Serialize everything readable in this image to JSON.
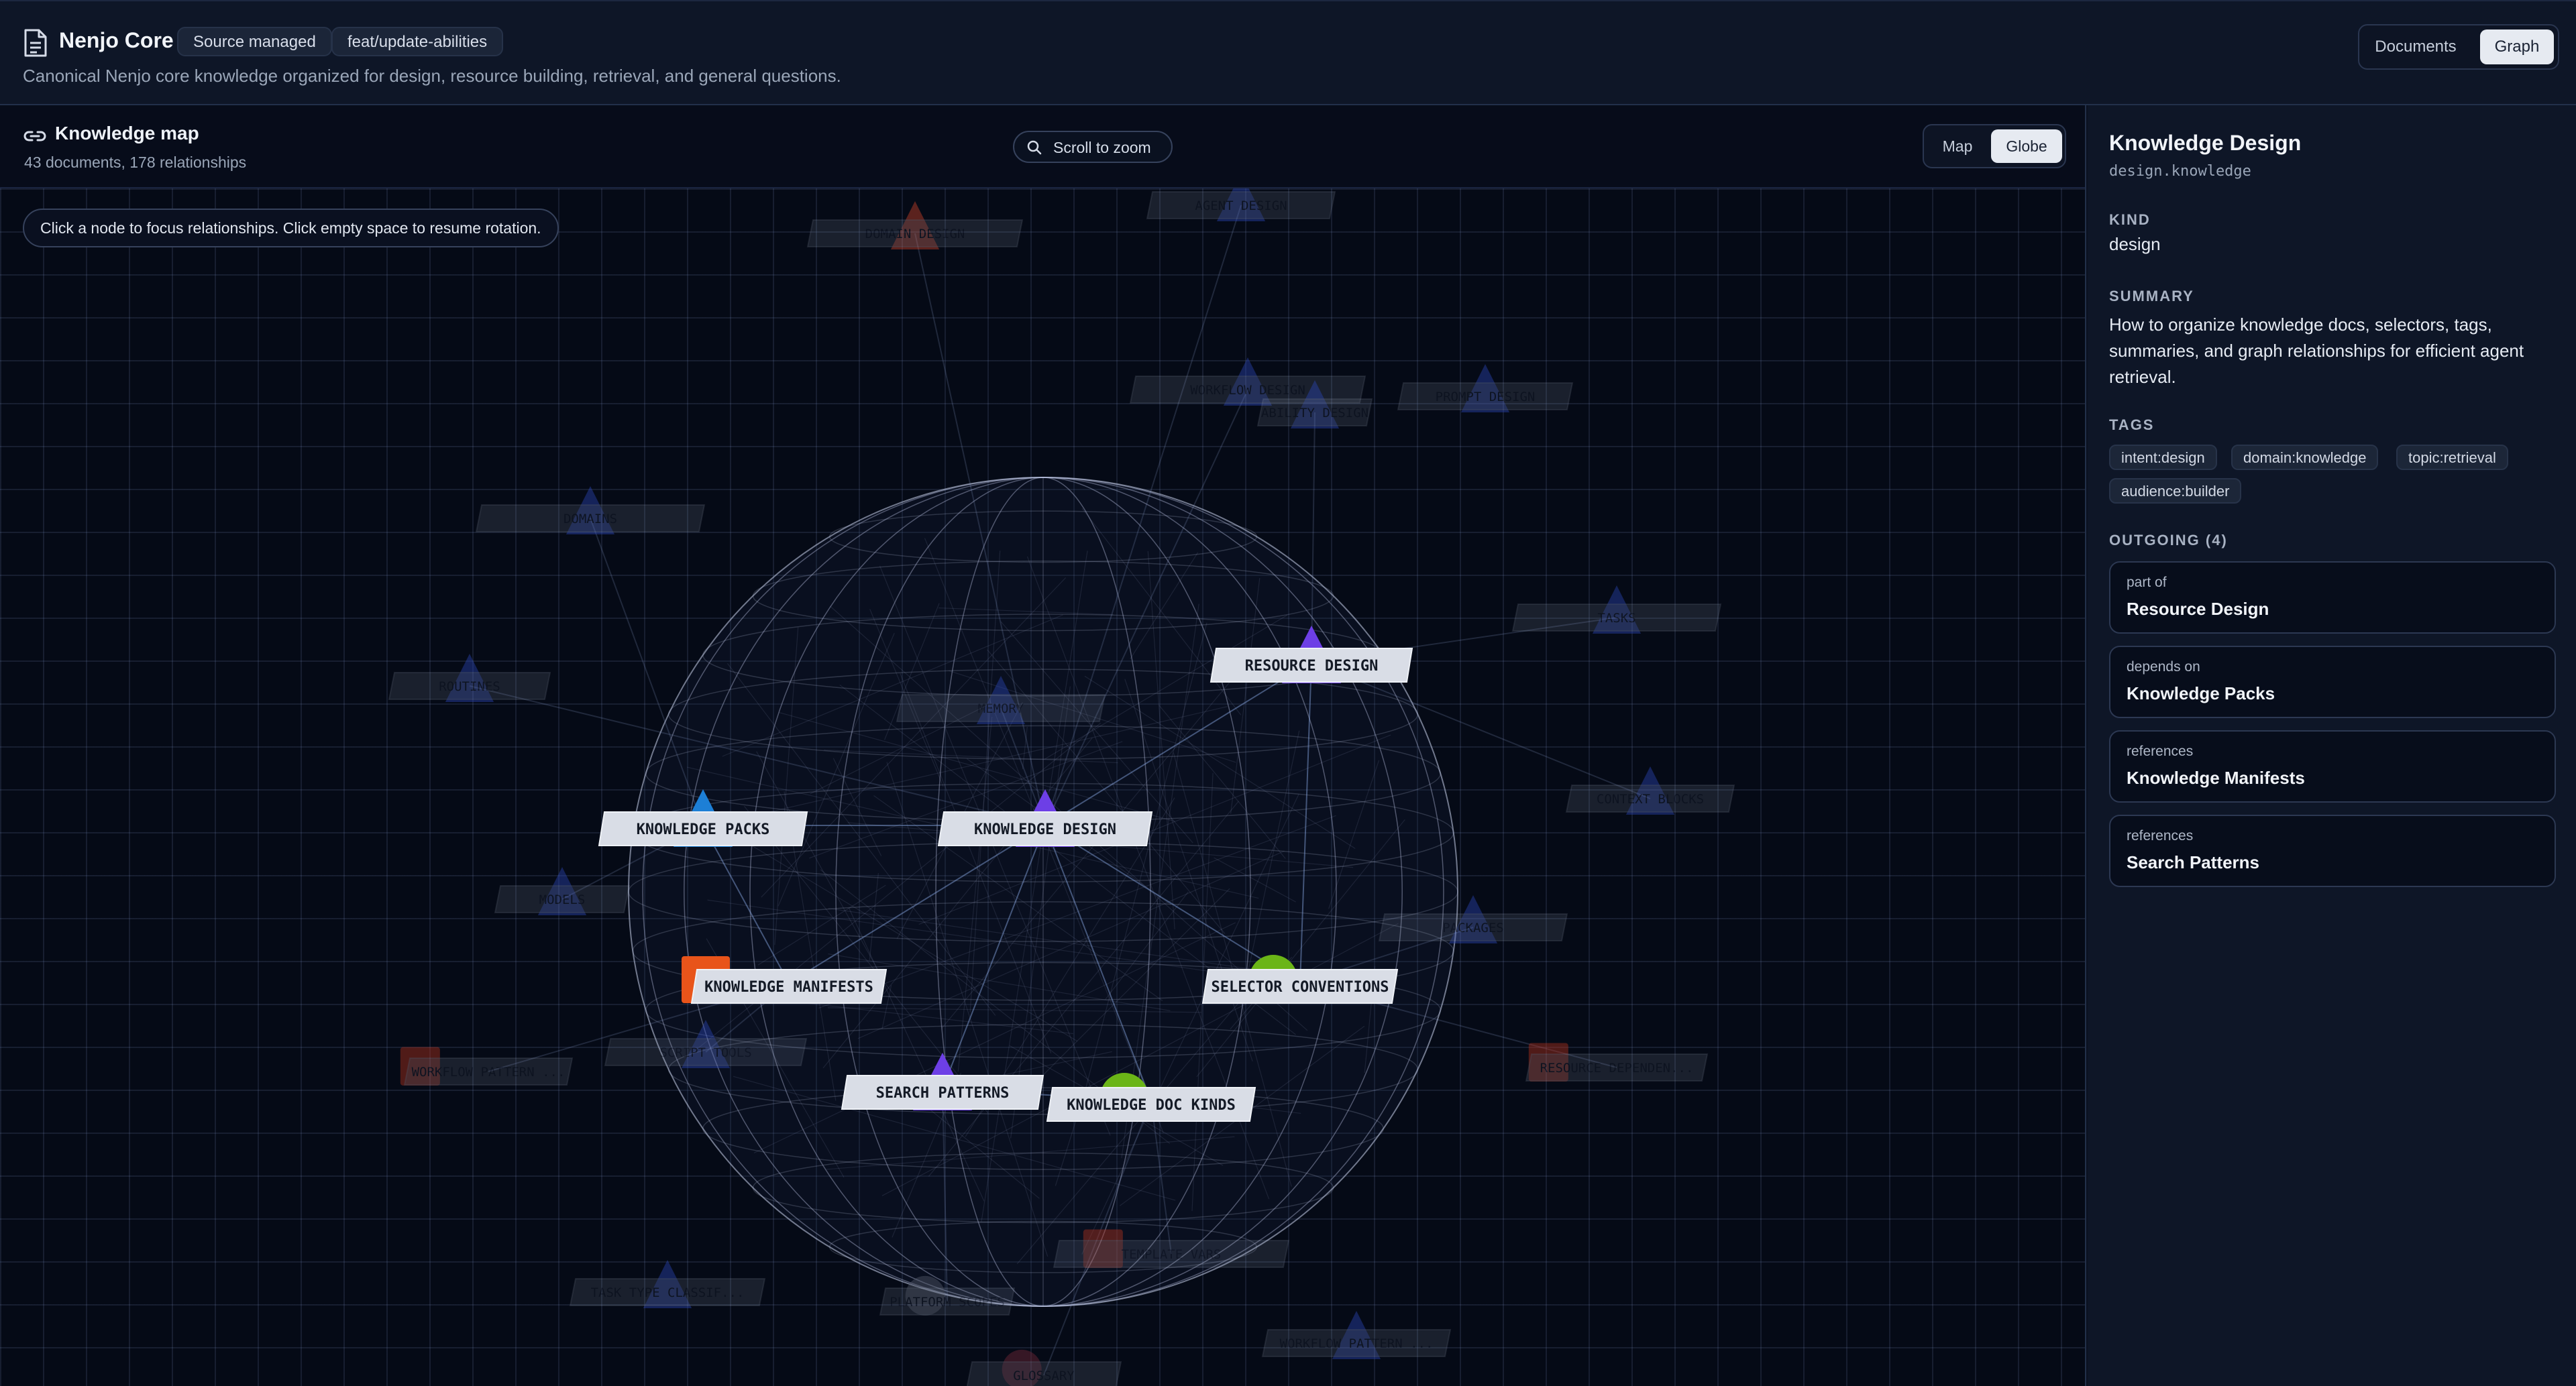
{
  "header": {
    "title": "Nenjo Core",
    "badges": [
      "Source managed",
      "feat/update-abilities"
    ],
    "subtitle": "Canonical Nenjo core knowledge organized for design, resource building, retrieval, and general questions.",
    "view_tabs": [
      "Documents",
      "Graph"
    ],
    "active_view": "Graph"
  },
  "graph": {
    "title": "Knowledge map",
    "subtitle": "43 documents, 178 relationships",
    "zoom_hint": "Scroll to zoom",
    "modes": [
      "Map",
      "Globe"
    ],
    "active_mode": "Globe",
    "hint": "Click a node to focus relationships. Click empty space to resume rotation.",
    "nodes": [
      {
        "label": "RESOURCE DESIGN",
        "shape": "triangle",
        "color": "#6d3fe6",
        "focus": true
      },
      {
        "label": "KNOWLEDGE PACKS",
        "shape": "triangle",
        "color": "#1d7fd6",
        "focus": true
      },
      {
        "label": "KNOWLEDGE DESIGN",
        "shape": "triangle",
        "color": "#6d3fe6",
        "focus": true
      },
      {
        "label": "KNOWLEDGE MANIFESTS",
        "shape": "cube",
        "color": "#e8541a",
        "focus": true
      },
      {
        "label": "SELECTOR CONVENTIONS",
        "shape": "sphere",
        "color": "#6bb517",
        "focus": true
      },
      {
        "label": "SEARCH PATTERNS",
        "shape": "triangle",
        "color": "#6d3fe6",
        "focus": true
      },
      {
        "label": "KNOWLEDGE DOC KINDS",
        "shape": "sphere",
        "color": "#6bb517",
        "focus": true
      },
      {
        "label": "DOMAIN DESIGN",
        "shape": "triangle",
        "color": "#d2452a",
        "focus": false
      },
      {
        "label": "AGENT DESIGN",
        "shape": "triangle",
        "color": "#2c47b8",
        "focus": false
      },
      {
        "label": "WORKFLOW DESIGN",
        "shape": "triangle",
        "color": "#2c47b8",
        "focus": false
      },
      {
        "label": "ABILITY DESIGN",
        "shape": "triangle",
        "color": "#2c47b8",
        "focus": false
      },
      {
        "label": "PROMPT DESIGN",
        "shape": "triangle",
        "color": "#2c47b8",
        "focus": false
      },
      {
        "label": "DOMAINS",
        "shape": "triangle",
        "color": "#2c47b8",
        "focus": false
      },
      {
        "label": "ROUTINES",
        "shape": "triangle",
        "color": "#2c47b8",
        "focus": false
      },
      {
        "label": "MEMORY",
        "shape": "triangle",
        "color": "#2c47b8",
        "focus": false
      },
      {
        "label": "TASKS",
        "shape": "triangle",
        "color": "#2c47b8",
        "focus": false
      },
      {
        "label": "CONTEXT BLOCKS",
        "shape": "triangle",
        "color": "#2c47b8",
        "focus": false
      },
      {
        "label": "MODELS",
        "shape": "triangle",
        "color": "#2c47b8",
        "focus": false
      },
      {
        "label": "PACKAGES",
        "shape": "triangle",
        "color": "#2c47b8",
        "focus": false
      },
      {
        "label": "SCRIPT TOOLS",
        "shape": "triangle",
        "color": "#2c47b8",
        "focus": false
      },
      {
        "label": "WORKFLOW PATTERN ...",
        "shape": "cube",
        "color": "#b8331d",
        "focus": false
      },
      {
        "label": "RESOURCE DEPENDEN...",
        "shape": "cube",
        "color": "#b8331d",
        "focus": false
      },
      {
        "label": "TEMPLATE VARS",
        "shape": "cube",
        "color": "#b8331d",
        "focus": false
      },
      {
        "label": "TASK TYPE CLASSIF...",
        "shape": "triangle",
        "color": "#2c47b8",
        "focus": false
      },
      {
        "label": "PLATFORM SCOPES",
        "shape": "sphere",
        "color": "#555c6b",
        "focus": false
      },
      {
        "label": "WORKFLOW PATTERN ...",
        "shape": "triangle",
        "color": "#2c47b8",
        "focus": false
      },
      {
        "label": "GLOSSARY",
        "shape": "sphere",
        "color": "#7a2a3a",
        "focus": false
      }
    ]
  },
  "details": {
    "title": "Knowledge Design",
    "slug": "design.knowledge",
    "kind_label": "KIND",
    "kind": "design",
    "summary_label": "SUMMARY",
    "summary": "How to organize knowledge docs, selectors, tags, summaries, and graph relationships for efficient agent retrieval.",
    "tags_label": "TAGS",
    "tags": [
      "intent:design",
      "domain:knowledge",
      "topic:retrieval",
      "audience:builder"
    ],
    "outgoing_label": "OUTGOING (4)",
    "outgoing": [
      {
        "kind": "part of",
        "target": "Resource Design"
      },
      {
        "kind": "depends on",
        "target": "Knowledge Packs"
      },
      {
        "kind": "references",
        "target": "Knowledge Manifests"
      },
      {
        "kind": "references",
        "target": "Search Patterns"
      }
    ]
  }
}
